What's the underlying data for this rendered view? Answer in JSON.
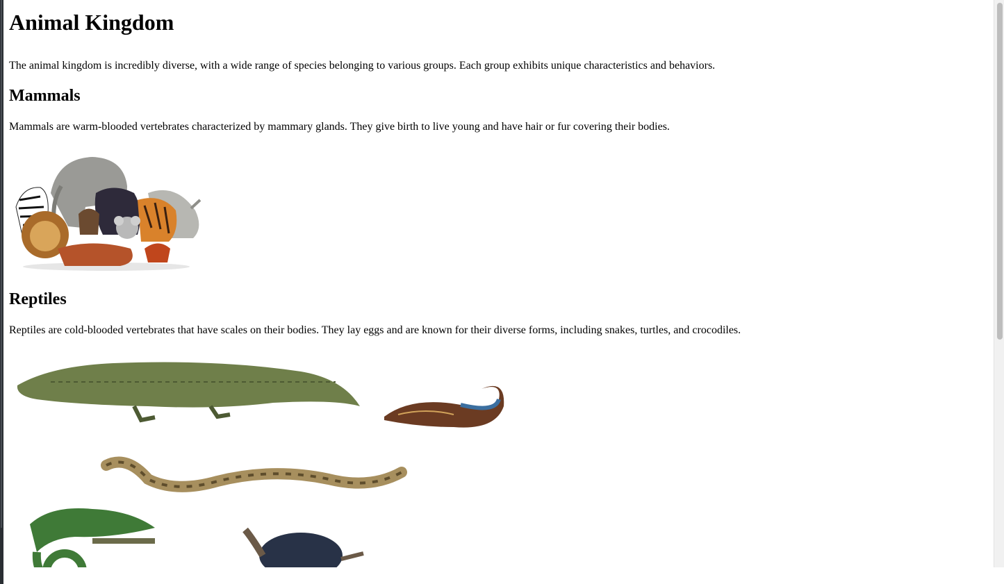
{
  "page": {
    "title": "Animal Kingdom",
    "intro": "The animal kingdom is incredibly diverse, with a wide range of species belonging to various groups. Each group exhibits unique characteristics and behaviors."
  },
  "sections": [
    {
      "heading": "Mammals",
      "text": "Mammals are warm-blooded vertebrates characterized by mammary glands. They give birth to live young and have hair or fur covering their bodies.",
      "image_alt": "Group of mammals"
    },
    {
      "heading": "Reptiles",
      "text": "Reptiles are cold-blooded vertebrates that have scales on their bodies. They lay eggs and are known for their diverse forms, including snakes, turtles, and crocodiles.",
      "image_alt": "Group of reptiles"
    }
  ]
}
